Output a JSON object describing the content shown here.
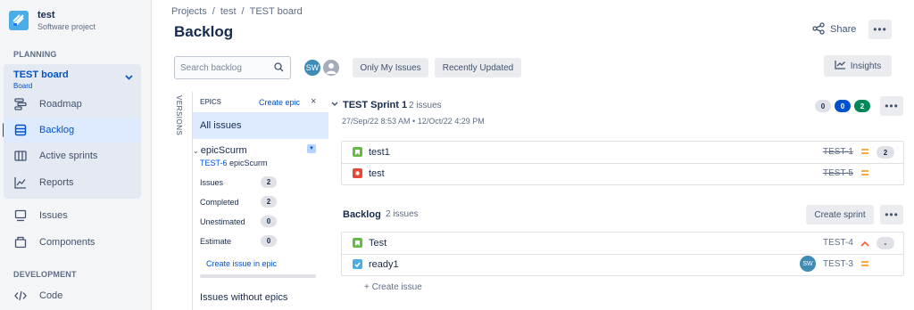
{
  "project": {
    "name": "test",
    "type": "Software project"
  },
  "sidebar": {
    "planning_label": "PLANNING",
    "board": {
      "title": "TEST board",
      "subtitle": "Board"
    },
    "items": [
      {
        "label": "Roadmap",
        "icon": "roadmap-icon"
      },
      {
        "label": "Backlog",
        "icon": "backlog-icon",
        "active": true
      },
      {
        "label": "Active sprints",
        "icon": "active-sprints-icon"
      },
      {
        "label": "Reports",
        "icon": "reports-icon"
      },
      {
        "label": "Issues",
        "icon": "issues-icon"
      },
      {
        "label": "Components",
        "icon": "components-icon"
      }
    ],
    "development_label": "DEVELOPMENT",
    "dev_items": [
      {
        "label": "Code",
        "icon": "code-icon"
      }
    ]
  },
  "breadcrumb": [
    "Projects",
    "/",
    "test",
    "/",
    "TEST board"
  ],
  "page_title": "Backlog",
  "header": {
    "share_label": "Share",
    "more_label": "•••"
  },
  "toolbar": {
    "search_placeholder": "Search backlog",
    "avatar_initials": "SW",
    "filter_only_my": "Only My Issues",
    "filter_recent": "Recently Updated",
    "insights_label": "Insights"
  },
  "epics_panel": {
    "versions_label": "VERSIONS",
    "title": "EPICS",
    "create_epic": "Create epic",
    "close": "×",
    "all_issues": "All issues",
    "epic": {
      "name": "epicScurm",
      "key": "TEST-6",
      "key_name": "epicScurm",
      "stats": [
        {
          "label": "Issues",
          "value": "2"
        },
        {
          "label": "Completed",
          "value": "2"
        },
        {
          "label": "Unestimated",
          "value": "0"
        },
        {
          "label": "Estimate",
          "value": "0"
        }
      ],
      "create_issue": "Create issue in epic"
    },
    "without_epics": "Issues without epics"
  },
  "sprint": {
    "title": "TEST Sprint 1",
    "count": "2 issues",
    "dates": "27/Sep/22 8:53 AM • 12/Oct/22 4:29 PM",
    "status_counts": [
      {
        "value": "0",
        "bg": "#DFE1E6",
        "fg": "#172B4D"
      },
      {
        "value": "0",
        "bg": "#0052CC",
        "fg": "#FFFFFF"
      },
      {
        "value": "2",
        "bg": "#00875A",
        "fg": "#FFFFFF"
      }
    ],
    "issues": [
      {
        "summary": "test1",
        "key": "TEST-1",
        "type": "story",
        "priority": "medium",
        "estimate": "2",
        "done": true
      },
      {
        "summary": "test",
        "key": "TEST-5",
        "type": "bug",
        "priority": "medium",
        "estimate": "",
        "done": true
      }
    ]
  },
  "backlog": {
    "title": "Backlog",
    "count": "2 issues",
    "create_sprint": "Create sprint",
    "issues": [
      {
        "summary": "Test",
        "key": "TEST-4",
        "type": "story",
        "priority": "high",
        "estimate": "-",
        "done": false
      },
      {
        "summary": "ready1",
        "key": "TEST-3",
        "type": "task",
        "priority": "medium",
        "estimate": "",
        "assignee": "SW",
        "done": false
      }
    ],
    "create_issue": "+ Create issue"
  },
  "colors": {
    "accent": "#0052CC",
    "story": "#65BA43",
    "bug": "#E5493A",
    "task": "#4BADE8",
    "priority_medium": "#FF8B00",
    "priority_high": "#FF5630"
  }
}
